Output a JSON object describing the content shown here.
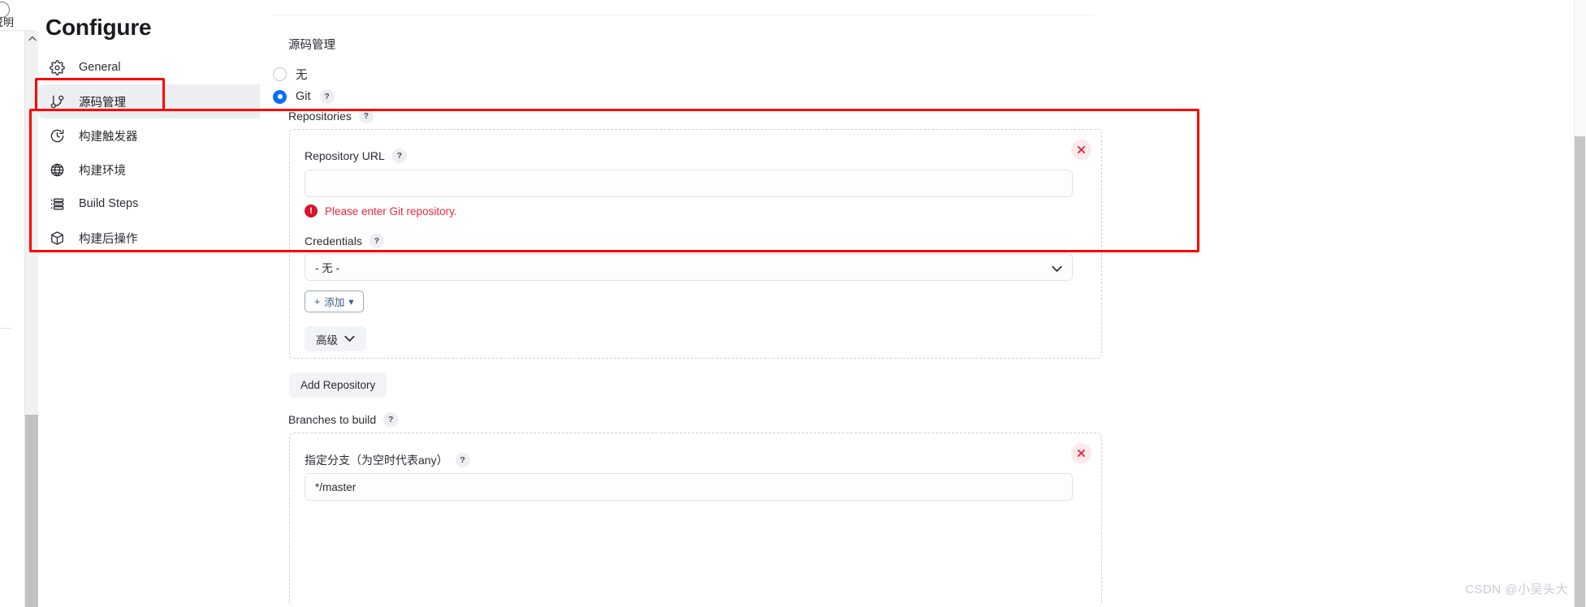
{
  "left_strip": {
    "icon": "info-circle-icon",
    "label": "说明"
  },
  "header": {
    "title": "Configure"
  },
  "sidebar": {
    "items": [
      {
        "label": "General",
        "icon": "gear-icon",
        "active": false
      },
      {
        "label": "源码管理",
        "icon": "git-branch-icon",
        "active": true
      },
      {
        "label": "构建触发器",
        "icon": "clock-icon",
        "active": false
      },
      {
        "label": "构建环境",
        "icon": "globe-icon",
        "active": false
      },
      {
        "label": "Build Steps",
        "icon": "list-icon",
        "active": false
      },
      {
        "label": "构建后操作",
        "icon": "package-icon",
        "active": false
      }
    ]
  },
  "main": {
    "section_title": "源码管理",
    "scm_options": [
      {
        "label": "无",
        "selected": false,
        "has_help": false
      },
      {
        "label": "Git",
        "selected": true,
        "has_help": true
      }
    ],
    "repositories": {
      "label": "Repositories",
      "help": "?",
      "remove_icon": "close-icon",
      "repository_url": {
        "label": "Repository URL",
        "help": "?",
        "value": "",
        "placeholder": ""
      },
      "error": {
        "icon": "error-icon",
        "glyph": "!",
        "message": "Please enter Git repository."
      },
      "credentials": {
        "label": "Credentials",
        "help": "?",
        "value": "- 无 -",
        "chevron": "chevron-down-icon",
        "add_button": "添加",
        "add_prefix": "+",
        "add_caret": "▾"
      },
      "advanced_button": {
        "label": "高级",
        "chevron": "chevron-down-icon"
      }
    },
    "add_repository_button": "Add Repository",
    "branches": {
      "label": "Branches to build",
      "help": "?",
      "remove_icon": "close-icon",
      "branch_spec": {
        "label": "指定分支（为空时代表any）",
        "help": "?",
        "value": "*/master"
      }
    }
  },
  "annotations": {
    "sidebar_highlight_color": "#ff0000",
    "main_highlight_color": "#ff0000"
  },
  "watermark": "CSDN @小吴头大",
  "colors": {
    "accent": "#0b6ef5",
    "error": "#e8283c",
    "active_nav_bg": "#eceef2",
    "dashed_border": "#ccd2e0"
  }
}
